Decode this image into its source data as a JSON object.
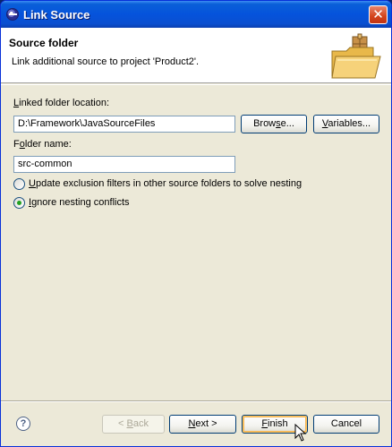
{
  "window": {
    "title": "Link Source"
  },
  "header": {
    "title": "Source folder",
    "description": "Link additional source to project 'Product2'."
  },
  "form": {
    "linked_folder_label_underlined": "L",
    "linked_folder_label_rest": "inked folder location:",
    "linked_folder_value": "D:\\Framework\\JavaSourceFiles",
    "browse_label_pre": "Brow",
    "browse_label_underlined": "s",
    "browse_label_post": "e...",
    "variables_label_underlined": "V",
    "variables_label_post": "ariables...",
    "folder_name_label_pre": "F",
    "folder_name_label_underlined": "o",
    "folder_name_label_post": "lder name:",
    "folder_name_value": "src-common",
    "option_update_underlined": "U",
    "option_update_rest": "pdate exclusion filters in other source folders to solve nesting",
    "option_ignore_underlined": "I",
    "option_ignore_rest": "gnore nesting conflicts",
    "selected_option": "ignore"
  },
  "footer": {
    "back_pre": "< ",
    "back_underlined": "B",
    "back_post": "ack",
    "next_underlined": "N",
    "next_post": "ext >",
    "finish_underlined": "F",
    "finish_post": "inish",
    "cancel_label": "Cancel"
  },
  "colors": {
    "title_bar": "#0553dc",
    "dialog_bg": "#ece9d8",
    "header_bg": "#ffffff"
  }
}
